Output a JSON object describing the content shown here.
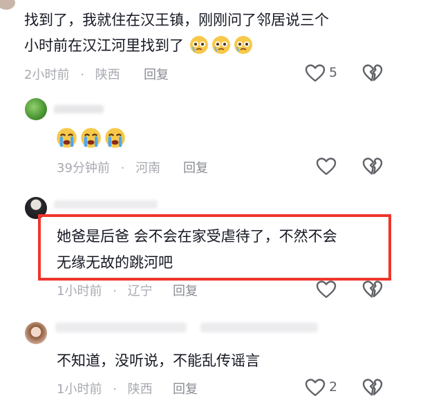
{
  "comments": [
    {
      "text_line1": "找到了，我就住在汉王镇，刚刚问了邻居说三个",
      "text_line2": "小时前在汉江河里找到了",
      "emoji": [
        "crying-face",
        "crying-face",
        "crying-face"
      ],
      "time": "2小时前",
      "location": "陕西",
      "reply_label": "回复",
      "like_count": "5"
    },
    {
      "emoji": [
        "loudly-crying-face",
        "loudly-crying-face",
        "loudly-crying-face"
      ],
      "time": "39分钟前",
      "location": "河南",
      "reply_label": "回复"
    },
    {
      "text_line1": "她爸是后爸  会不会在家受虐待了，不然不会",
      "text_line2": "无缘无故的跳河吧",
      "time": "1小时前",
      "location": "辽宁",
      "reply_label": "回复",
      "highlight_color": "#f0352b"
    },
    {
      "text": "不知道，没听说，不能乱传谣言",
      "time": "1小时前",
      "location": "陕西",
      "reply_label": "回复",
      "like_count": "2"
    }
  ],
  "separator": "·",
  "icons": [
    "heart-outline-icon",
    "broken-heart-icon"
  ]
}
